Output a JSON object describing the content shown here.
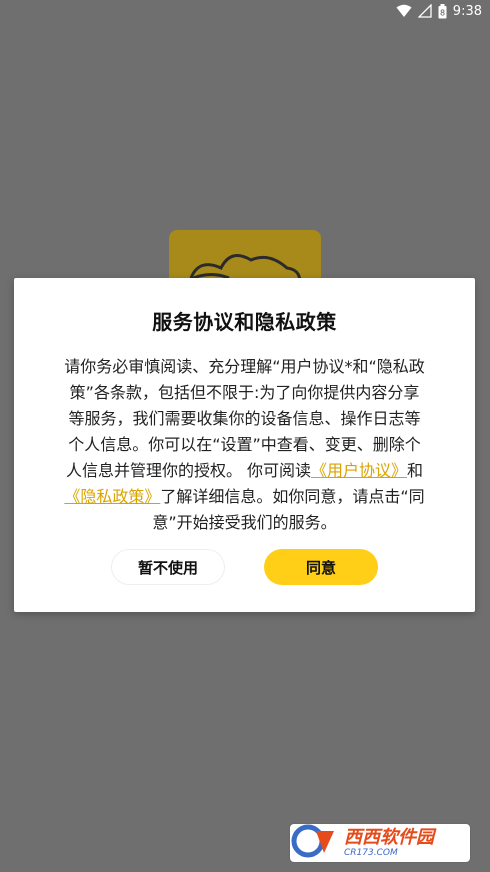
{
  "status_bar": {
    "time": "9:38",
    "battery_level": "8"
  },
  "dialog": {
    "title": "服务协议和隐私政策",
    "body_part1": "请你务必审慎阅读、充分理解“用户协议*和“隐私政策”各条款，包括但不限于:为了向你提供内容分享等服务，我们需要收集你的设备信息、操作日志等个人信息。你可以在“设置”中查看、变更、删除个人信息并管理你的授权。 你可阅读",
    "link_user_agreement": "《用户协议》",
    "and_text": "和",
    "link_privacy_policy": "《隐私政策》",
    "body_part2": "了解详细信息。如你同意，请点击“同意”开始接受我们的服务。",
    "cancel_button": "暂不使用",
    "agree_button": "同意"
  },
  "watermark": {
    "main": "西西软件园",
    "sub": "CR173.COM"
  },
  "colors": {
    "accent": "#ffcf17",
    "link": "#d9a400",
    "overlay": "#6f6f6f"
  }
}
